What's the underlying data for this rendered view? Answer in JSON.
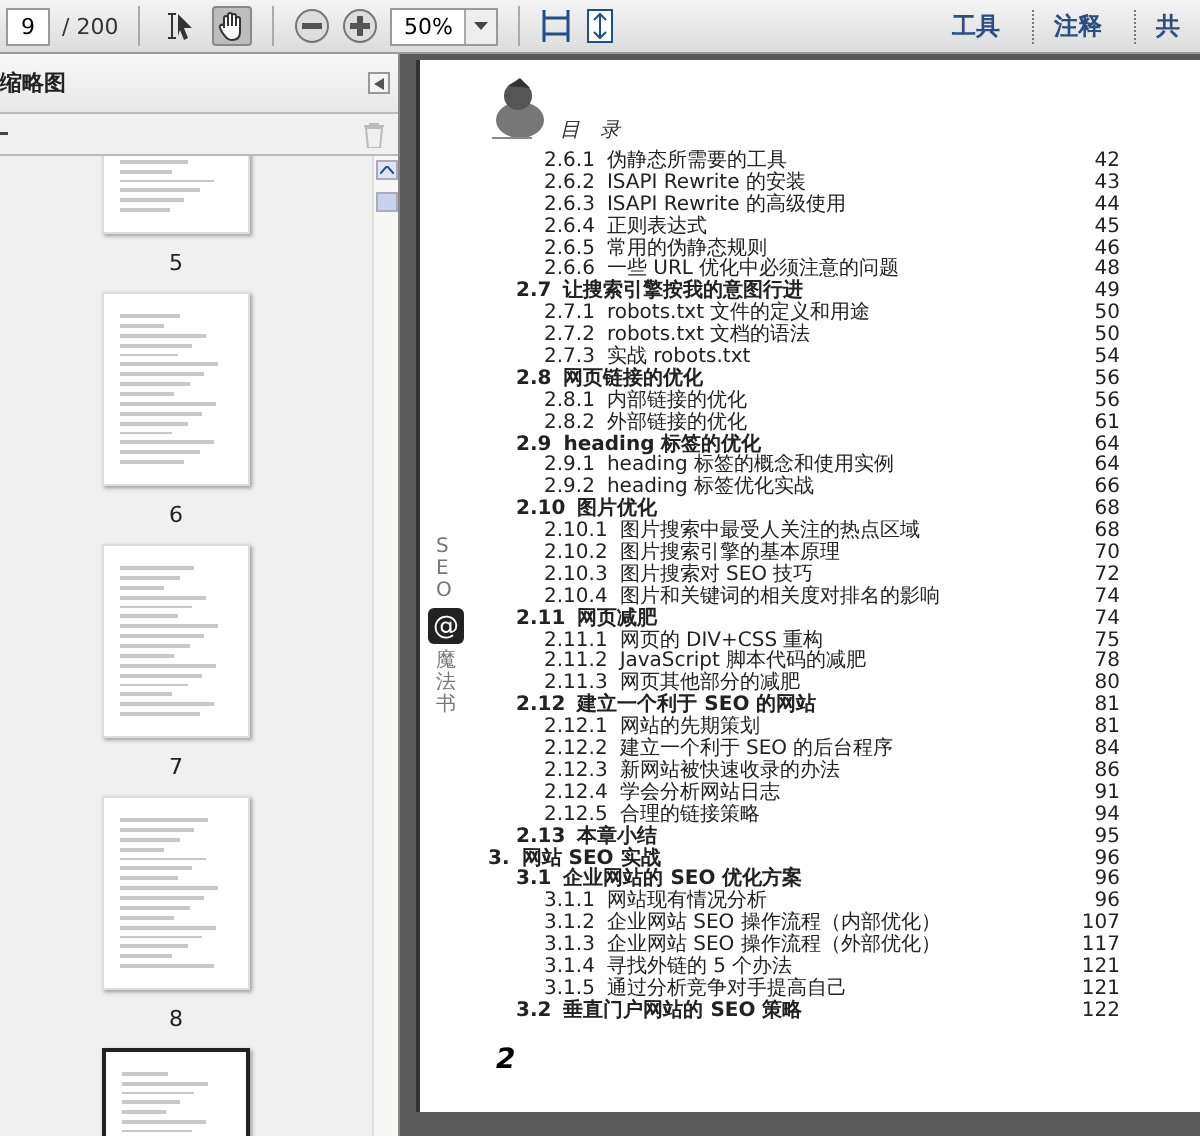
{
  "toolbar": {
    "page_number": "9",
    "page_total": "/ 200",
    "tools": [
      {
        "kind": "select",
        "selected": false
      },
      {
        "kind": "hand",
        "selected": true
      }
    ],
    "zoom": "50%",
    "pane_buttons": [
      "工具",
      "注释",
      "共"
    ]
  },
  "sidebar": {
    "title": "缩略图",
    "thumbnails": [
      {
        "label": "5",
        "selected": false
      },
      {
        "label": "6",
        "selected": false
      },
      {
        "label": "7",
        "selected": false
      },
      {
        "label": "8",
        "selected": false
      },
      {
        "selected": true
      }
    ]
  },
  "page": {
    "header": "目　录",
    "spine": {
      "top": "SEO",
      "logo": "@",
      "bottom": "魔法书"
    },
    "toc": {
      "leading_entries": [
        {
          "number": "2.6.1",
          "title": "伪静态所需要的工具",
          "page": "42"
        },
        {
          "number": "2.6.2",
          "title": "ISAPI Rewrite 的安装",
          "page": "43"
        },
        {
          "number": "2.6.3",
          "title": "ISAPI Rewrite 的高级使用",
          "page": "44"
        },
        {
          "number": "2.6.4",
          "title": "正则表达式",
          "page": "45"
        },
        {
          "number": "2.6.5",
          "title": "常用的伪静态规则",
          "page": "46"
        },
        {
          "number": "2.6.6",
          "title": "一些 URL 优化中必须注意的问题",
          "page": "48"
        }
      ],
      "entries": [
        {
          "number": "2.7",
          "title": "让搜索引擎按我的意图行进",
          "page": "49",
          "children": [
            {
              "number": "2.7.1",
              "title": "robots.txt 文件的定义和用途",
              "page": "50"
            },
            {
              "number": "2.7.2",
              "title": "robots.txt 文档的语法",
              "page": "50"
            },
            {
              "number": "2.7.3",
              "title": "实战 robots.txt",
              "page": "54"
            }
          ]
        },
        {
          "number": "2.8",
          "title": "网页链接的优化",
          "page": "56",
          "children": [
            {
              "number": "2.8.1",
              "title": "内部链接的优化",
              "page": "56"
            },
            {
              "number": "2.8.2",
              "title": "外部链接的优化",
              "page": "61"
            }
          ]
        },
        {
          "number": "2.9",
          "title": "heading 标签的优化",
          "page": "64",
          "children": [
            {
              "number": "2.9.1",
              "title": "heading 标签的概念和使用实例",
              "page": "64"
            },
            {
              "number": "2.9.2",
              "title": "heading 标签优化实战",
              "page": "66"
            }
          ]
        },
        {
          "number": "2.10",
          "title": "图片优化",
          "page": "68",
          "children": [
            {
              "number": "2.10.1",
              "title": "图片搜索中最受人关注的热点区域",
              "page": "68"
            },
            {
              "number": "2.10.2",
              "title": "图片搜索引擎的基本原理",
              "page": "70"
            },
            {
              "number": "2.10.3",
              "title": "图片搜索对 SEO 技巧",
              "page": "72"
            },
            {
              "number": "2.10.4",
              "title": "图片和关键词的相关度对排名的影响",
              "page": "74"
            }
          ]
        },
        {
          "number": "2.11",
          "title": "网页减肥",
          "page": "74",
          "children": [
            {
              "number": "2.11.1",
              "title": "网页的 DIV+CSS 重构",
              "page": "75"
            },
            {
              "number": "2.11.2",
              "title": "JavaScript 脚本代码的减肥",
              "page": "78"
            },
            {
              "number": "2.11.3",
              "title": "网页其他部分的减肥",
              "page": "80"
            }
          ]
        },
        {
          "number": "2.12",
          "title": "建立一个利于 SEO 的网站",
          "page": "81",
          "children": [
            {
              "number": "2.12.1",
              "title": "网站的先期策划",
              "page": "81"
            },
            {
              "number": "2.12.2",
              "title": "建立一个利于 SEO 的后台程序",
              "page": "84"
            },
            {
              "number": "2.12.3",
              "title": "新网站被快速收录的办法",
              "page": "86"
            },
            {
              "number": "2.12.4",
              "title": "学会分析网站日志",
              "page": "91"
            },
            {
              "number": "2.12.5",
              "title": "合理的链接策略",
              "page": "94"
            }
          ]
        },
        {
          "number": "2.13",
          "title": "本章小结",
          "page": "95"
        }
      ],
      "chapters": [
        {
          "number": "3.",
          "title": "网站 SEO 实战",
          "page": "96",
          "children": [
            {
              "number": "3.1",
              "title": "企业网站的 SEO 优化方案",
              "page": "96",
              "children": [
                {
                  "number": "3.1.1",
                  "title": "网站现有情况分析",
                  "page": "96"
                },
                {
                  "number": "3.1.2",
                  "title": "企业网站 SEO 操作流程（内部优化）",
                  "page": "107"
                },
                {
                  "number": "3.1.3",
                  "title": "企业网站 SEO 操作流程（外部优化）",
                  "page": "117"
                },
                {
                  "number": "3.1.4",
                  "title": "寻找外链的 5 个办法",
                  "page": "121"
                },
                {
                  "number": "3.1.5",
                  "title": "通过分析竞争对手提高自己",
                  "page": "121"
                }
              ]
            },
            {
              "number": "3.2",
              "title": "垂直门户网站的 SEO 策略",
              "page": "122"
            }
          ]
        }
      ]
    },
    "page_number": "2"
  }
}
